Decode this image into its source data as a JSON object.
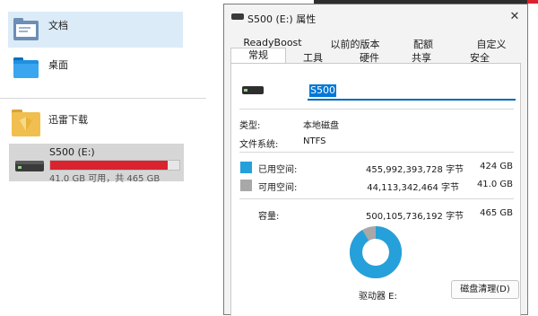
{
  "explorer": {
    "items": [
      {
        "label": "文档",
        "icon": "documents-folder-icon"
      },
      {
        "label": "桌面",
        "icon": "desktop-folder-icon"
      },
      {
        "label": "迅雷下载",
        "icon": "download-folder-icon"
      }
    ],
    "drive": {
      "name": "S500 (E:)",
      "space_text": "41.0 GB 可用，共 465 GB",
      "used_fraction": 0.912,
      "icon": "drive-icon"
    }
  },
  "dialog": {
    "title": "S500 (E:) 属性",
    "close_glyph": "✕",
    "tabs_top": [
      "ReadyBoost",
      "以前的版本",
      "配额",
      "自定义"
    ],
    "tabs_bottom": [
      "常规",
      "工具",
      "硬件",
      "共享",
      "安全"
    ],
    "active_tab": "常规",
    "drive_name": "S500",
    "type_label": "类型:",
    "type_value": "本地磁盘",
    "fs_label": "文件系统:",
    "fs_value": "NTFS",
    "used": {
      "label": "已用空间:",
      "bytes": "455,992,393,728 字节",
      "size": "424 GB",
      "color": "#26a0da"
    },
    "free": {
      "label": "可用空间:",
      "bytes": "44,113,342,464 字节",
      "size": "41.0 GB",
      "color": "#a8a8a8"
    },
    "capacity": {
      "label": "容量:",
      "bytes": "500,105,736,192 字节",
      "size": "465 GB"
    },
    "used_fraction": 0.912,
    "drive_letter_label": "驱动器 E:",
    "cleanup_button": "磁盘清理(D)"
  },
  "colors": {
    "accent": "#0078d7",
    "used": "#26a0da",
    "free": "#a8a8a8",
    "bar_fill": "#d9232e"
  }
}
